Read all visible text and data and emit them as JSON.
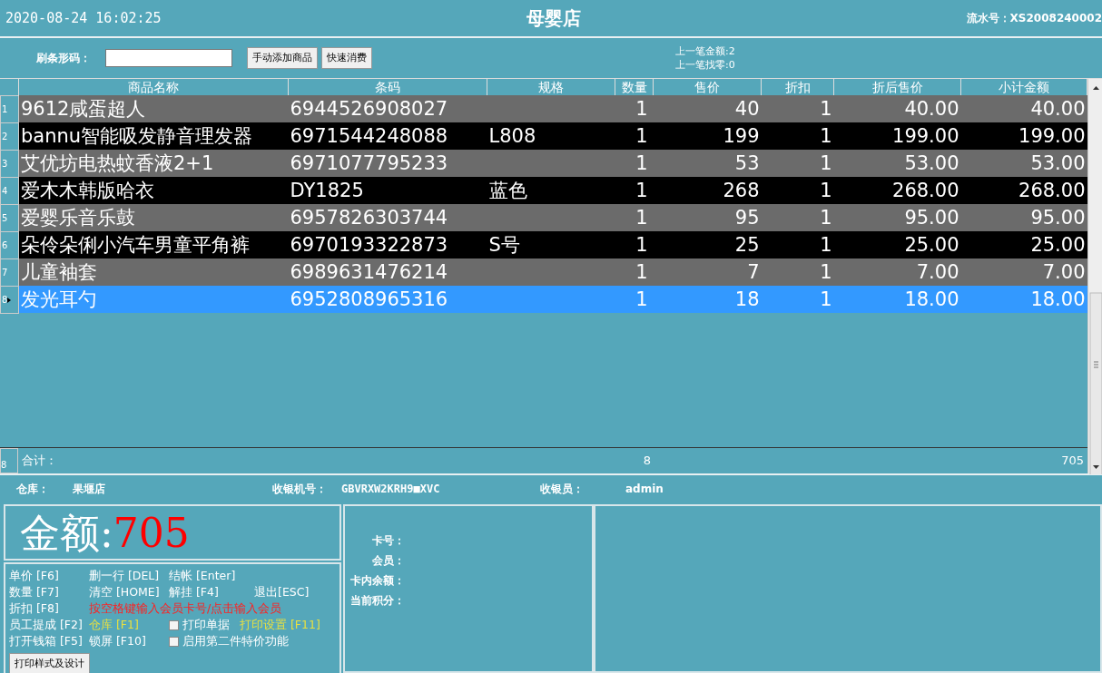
{
  "header": {
    "datetime": "2020-08-24 16:02:25",
    "store_title": "母婴店",
    "serial_label": "流水号：",
    "serial_value": "XS2008240002"
  },
  "toolbar": {
    "barcode_label": "刷条形码：",
    "buttons": [
      "手动添加商品",
      "快速消费"
    ],
    "last_amount": "上一笔金额:2",
    "last_change": "上一笔找零:0"
  },
  "table": {
    "columns": [
      "商品名称",
      "条码",
      "规格",
      "数量",
      "售价",
      "折扣",
      "折后售价",
      "小计金额"
    ],
    "rows": [
      {
        "row_number": "1",
        "cells": [
          "9612咸蛋超人",
          "6944526908027",
          "",
          "1",
          "40",
          "1",
          "40.00",
          "40.00"
        ],
        "selected": false
      },
      {
        "row_number": "2",
        "cells": [
          "bannu智能吸发静音理发器",
          "6971544248088",
          "L808",
          "1",
          "199",
          "1",
          "199.00",
          "199.00"
        ],
        "selected": false
      },
      {
        "row_number": "3",
        "cells": [
          "艾优坊电热蚊香液2+1",
          "6971077795233",
          "",
          "1",
          "53",
          "1",
          "53.00",
          "53.00"
        ],
        "selected": false
      },
      {
        "row_number": "4",
        "cells": [
          "爱木木韩版哈衣",
          "DY1825",
          "蓝色",
          "1",
          "268",
          "1",
          "268.00",
          "268.00"
        ],
        "selected": false
      },
      {
        "row_number": "5",
        "cells": [
          "爱婴乐音乐鼓",
          "6957826303744",
          "",
          "1",
          "95",
          "1",
          "95.00",
          "95.00"
        ],
        "selected": false
      },
      {
        "row_number": "6",
        "cells": [
          "朵伶朵俐小汽车男童平角裤",
          "6970193322873",
          "S号",
          "1",
          "25",
          "1",
          "25.00",
          "25.00"
        ],
        "selected": false
      },
      {
        "row_number": "7",
        "cells": [
          "儿童袖套",
          "6989631476214",
          "",
          "1",
          "7",
          "1",
          "7.00",
          "7.00"
        ],
        "selected": false
      },
      {
        "row_number": "8",
        "cells": [
          "发光耳勺",
          "6952808965316",
          "",
          "1",
          "18",
          "1",
          "18.00",
          "18.00"
        ],
        "selected": true
      }
    ],
    "totals": {
      "row_number": "8",
      "label": "合计：",
      "quantity": "8",
      "amount": "705"
    }
  },
  "info": [
    {
      "label": "仓库：",
      "value": "果堰店"
    },
    {
      "label": "收银机号：",
      "value": "GBVRXW2KRH9■XVC"
    },
    {
      "label": "收银员：",
      "value": "admin"
    }
  ],
  "amount": {
    "label": "金额:",
    "value": "705"
  },
  "hotkeys": [
    [
      {
        "kind": "text",
        "text": "单价 [F6]",
        "color": "#ffffff"
      },
      {
        "kind": "text",
        "text": "删一行 [DEL]",
        "color": "#ffffff"
      },
      {
        "kind": "text",
        "text": "结帐 [Enter]",
        "color": "#ffffff"
      }
    ],
    [
      {
        "kind": "text",
        "text": "数量 [F7]",
        "color": "#ffffff"
      },
      {
        "kind": "text",
        "text": "清空 [HOME]",
        "color": "#ffffff"
      },
      {
        "kind": "text",
        "text": "解挂 [F4]",
        "color": "#ffffff"
      },
      {
        "kind": "text",
        "text": "退出[ESC]",
        "color": "#ffffff"
      }
    ],
    [
      {
        "kind": "text",
        "text": "折扣 [F8]",
        "color": "#ffffff"
      },
      {
        "kind": "text",
        "text": "按空格键输入会员卡号/点击输入会员",
        "color": "#ff2020"
      }
    ],
    [
      {
        "kind": "text",
        "text": "员工提成 [F2]",
        "color": "#ffffff"
      },
      {
        "kind": "text",
        "text": "仓库 [F1]",
        "color": "#e8e040"
      },
      {
        "kind": "checkbox",
        "text": "打印单据",
        "checked": false
      },
      {
        "kind": "text",
        "text": "打印设置  [F11]",
        "color": "#e8e040"
      }
    ],
    [
      {
        "kind": "text",
        "text": "打开钱箱 [F5]",
        "color": "#ffffff"
      },
      {
        "kind": "text",
        "text": "锁屏 [F10]",
        "color": "#ffffff"
      },
      {
        "kind": "checkbox",
        "text": "启用第二件特价功能",
        "checked": false
      }
    ]
  ],
  "print_button": "打印样式及设计",
  "member": [
    "卡号：",
    "会员：",
    "卡内余额：",
    "当前积分："
  ]
}
